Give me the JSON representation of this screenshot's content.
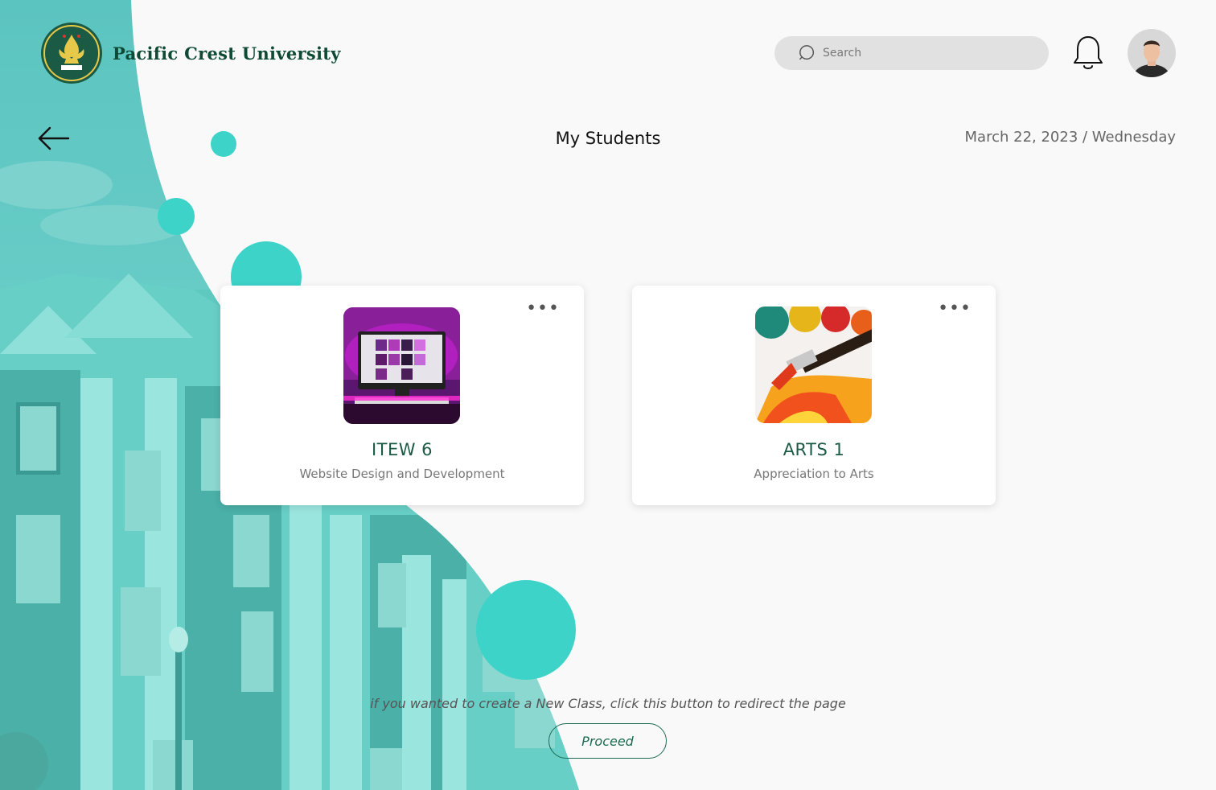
{
  "brand": {
    "university_name": "Pacific Crest University",
    "logo_icon": "university-crest-emblem",
    "primary_color": "#0f4a35",
    "accent_color": "#3dd3c8"
  },
  "header": {
    "search_placeholder": "Search",
    "search_icon": "search-icon",
    "notification_icon": "bell-icon",
    "avatar_icon": "user-avatar"
  },
  "page": {
    "back_icon": "arrow-left-icon",
    "title": "My Students",
    "date": "March 22, 2023 / Wednesday"
  },
  "classes": [
    {
      "code": "ITEW 6",
      "name": "Website Design and Development",
      "thumbnail": "computer-monitor-pink-light",
      "menu_icon": "more-horizontal-icon",
      "menu_label": "•••"
    },
    {
      "code": "ARTS 1",
      "name": "Appreciation to Arts",
      "thumbnail": "paint-brush-orange",
      "menu_icon": "more-horizontal-icon",
      "menu_label": "•••"
    }
  ],
  "footer": {
    "hint": "if you wanted to create a New Class, click this button to redirect the page",
    "proceed_label": "Proceed"
  }
}
